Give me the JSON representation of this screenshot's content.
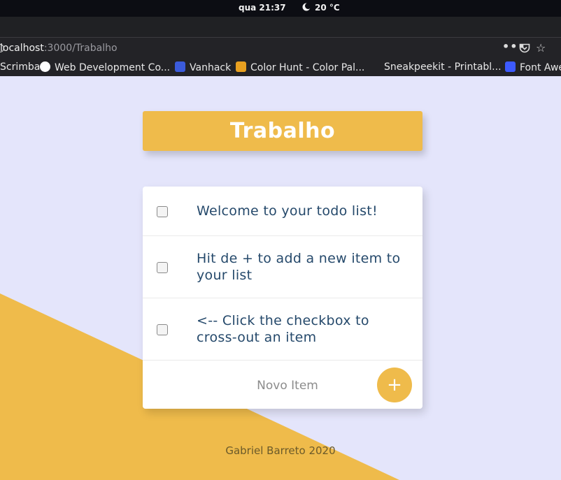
{
  "system": {
    "clock": "qua 21:37",
    "weather": "20 °C"
  },
  "browser": {
    "url_host": "localhost",
    "url_path": ":3000/Trabalho",
    "bookmarks": [
      {
        "label": "Scrimba",
        "color": "#232327"
      },
      {
        "label": "Web Development Co...",
        "color": "#f4c430"
      },
      {
        "label": "Vanhack",
        "color": "#3b5bdb"
      },
      {
        "label": "Color Hunt - Color Pal...",
        "color": "#e8a020"
      },
      {
        "label": "Sneakpeekit - Printabl...",
        "color": "#232327"
      },
      {
        "label": "Font Awe",
        "color": "#3d5afe"
      }
    ]
  },
  "page": {
    "title": "Trabalho",
    "items": [
      {
        "text": "Welcome to your todo list!",
        "checked": false
      },
      {
        "text": "Hit de + to add a new item to your list",
        "checked": false
      },
      {
        "text": "<-- Click the checkbox to cross-out an item",
        "checked": false
      }
    ],
    "new_item_placeholder": "Novo Item",
    "add_button_label": "+",
    "footer": "Gabriel Barreto 2020"
  },
  "colors": {
    "background": "#e4e5fb",
    "accent": "#efbb4b",
    "item_text": "#25496b"
  }
}
